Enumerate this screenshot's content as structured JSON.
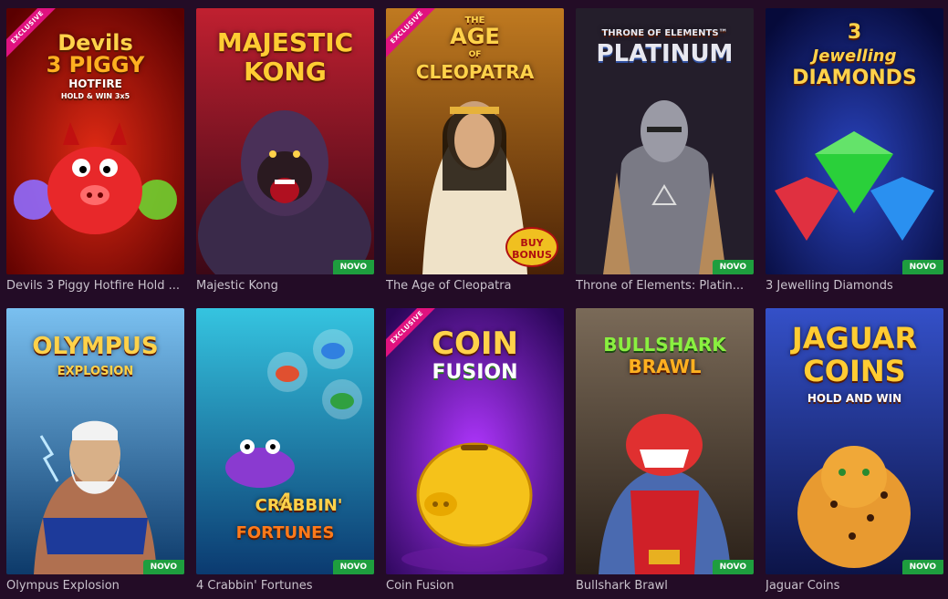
{
  "games": [
    {
      "title": "Devils 3 Piggy Hotfire Hold ...",
      "logo": [
        "Devils",
        "3 PIGGY",
        "HOTFIRE",
        "HOLD & WIN 3x5"
      ],
      "exclusive": "EXCLUSIVE",
      "badge": "",
      "colors": [
        "#c41010",
        "#5a0000"
      ]
    },
    {
      "title": "Majestic Kong",
      "logo": [
        "MAJESTIC",
        "KONG"
      ],
      "exclusive": "",
      "badge": "NOVO",
      "colors": [
        "#b0202a",
        "#3c0816"
      ]
    },
    {
      "title": "The Age of Cleopatra",
      "logo": [
        "THE",
        "AGE",
        "OF",
        "CLEOPATRA"
      ],
      "exclusive": "EXCLUSIVE",
      "badge": "",
      "buy_bonus": "BUY BONUS",
      "colors": [
        "#b86a12",
        "#4a2206"
      ]
    },
    {
      "title": "Throne of Elements: Platin...",
      "logo": [
        "THRONE OF ELEMENTS™",
        "PLATINUM"
      ],
      "exclusive": "",
      "badge": "NOVO",
      "colors": [
        "#2c2433",
        "#120c18"
      ]
    },
    {
      "title": "3 Jewelling Diamonds",
      "logo": [
        "3",
        "Jewelling",
        "DIAMONDS"
      ],
      "exclusive": "",
      "badge": "NOVO",
      "colors": [
        "#1a2b8a",
        "#060a3a"
      ]
    },
    {
      "title": "Olympus Explosion",
      "logo": [
        "OLYMPUS",
        "EXPLOSION"
      ],
      "exclusive": "",
      "badge": "NOVO",
      "colors": [
        "#5aa0e0",
        "#0d4a7a"
      ]
    },
    {
      "title": "4 Crabbin' Fortunes",
      "logo": [
        "4",
        "CRABBIN'",
        "FORTUNES"
      ],
      "exclusive": "",
      "badge": "NOVO",
      "colors": [
        "#2ab6d8",
        "#0b3a70"
      ]
    },
    {
      "title": "Coin Fusion",
      "logo": [
        "COIN",
        "FUSION"
      ],
      "exclusive": "EXCLUSIVE",
      "badge": "",
      "colors": [
        "#8c1fd8",
        "#3a0a6e"
      ]
    },
    {
      "title": "Bullshark Brawl",
      "logo": [
        "BULLSHARK",
        "BRAWL"
      ],
      "exclusive": "",
      "badge": "NOVO",
      "colors": [
        "#6a5a4a",
        "#2a2018"
      ]
    },
    {
      "title": "Jaguar Coins",
      "logo": [
        "JAGUAR",
        "COINS",
        "HOLD AND WIN"
      ],
      "exclusive": "",
      "badge": "NOVO",
      "colors": [
        "#2b3fa8",
        "#0c1448"
      ]
    }
  ]
}
